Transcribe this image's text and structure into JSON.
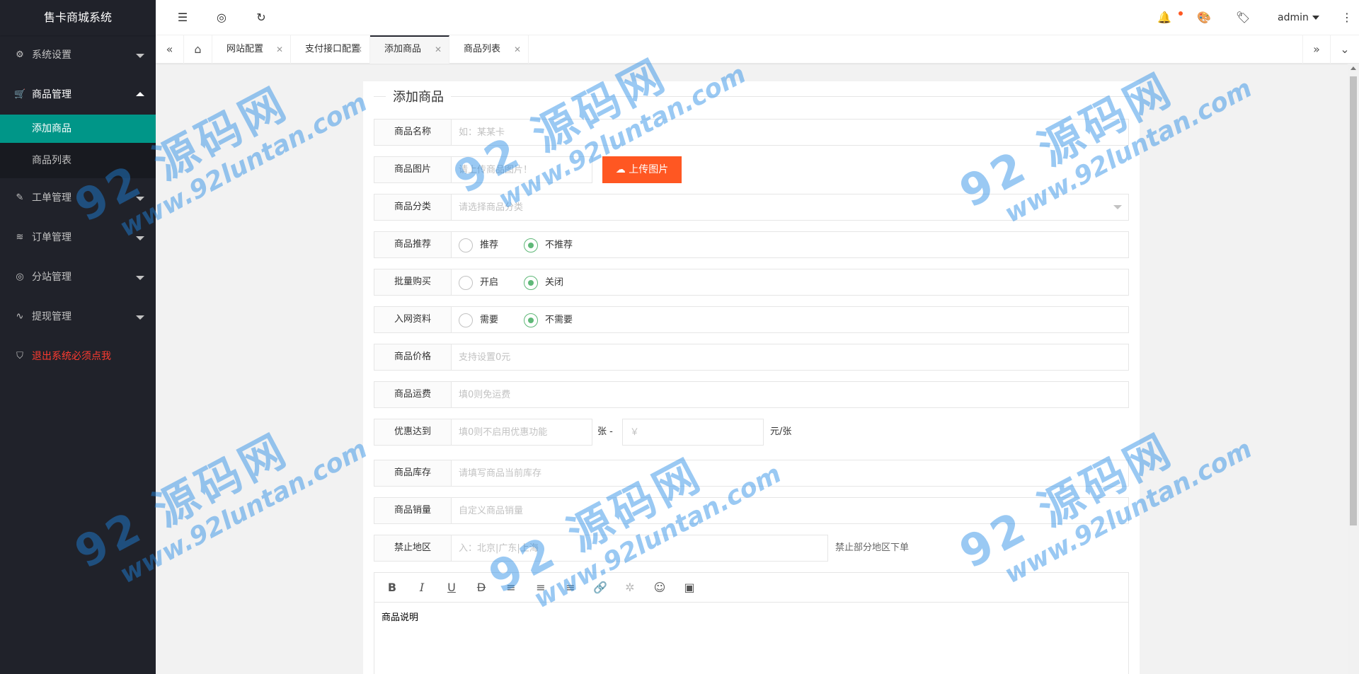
{
  "app": {
    "title": "售卡商城系统"
  },
  "sidebar": {
    "items": [
      {
        "label": "系统设置",
        "icon": "gear-icon"
      },
      {
        "label": "商品管理",
        "icon": "cart-icon"
      },
      {
        "label": "工单管理",
        "icon": "ticket-icon"
      },
      {
        "label": "订单管理",
        "icon": "layers-icon"
      },
      {
        "label": "分站管理",
        "icon": "globe-icon"
      },
      {
        "label": "提现管理",
        "icon": "pulse-icon"
      },
      {
        "label": "退出系统必须点我",
        "icon": "shield-icon"
      }
    ],
    "subitems": [
      {
        "label": "添加商品"
      },
      {
        "label": "商品列表"
      }
    ]
  },
  "header": {
    "user": "admin"
  },
  "tabs": [
    {
      "label": "网站配置"
    },
    {
      "label": "支付接口配置"
    },
    {
      "label": "添加商品"
    },
    {
      "label": "商品列表"
    }
  ],
  "form": {
    "legend": "添加商品",
    "name": {
      "label": "商品名称",
      "placeholder": "如：某某卡"
    },
    "image": {
      "label": "商品图片",
      "placeholder": "请上传商品图片！",
      "button": "上传图片"
    },
    "category": {
      "label": "商品分类",
      "placeholder": "请选择商品分类"
    },
    "recommend": {
      "label": "商品推荐",
      "options": [
        "推荐",
        "不推荐"
      ],
      "selected": "不推荐"
    },
    "batch": {
      "label": "批量购买",
      "options": [
        "开启",
        "关闭"
      ],
      "selected": "关闭"
    },
    "netinfo": {
      "label": "入网资料",
      "options": [
        "需要",
        "不需要"
      ],
      "selected": "不需要"
    },
    "price": {
      "label": "商品价格",
      "placeholder": "支持设置0元"
    },
    "shipping": {
      "label": "商品运费",
      "placeholder": "填0则免运费"
    },
    "discount": {
      "label": "优惠达到",
      "placeholder1": "填0则不启用优惠功能",
      "sep": "张 -",
      "placeholder2": "￥",
      "unit": "元/张"
    },
    "stock": {
      "label": "商品库存",
      "placeholder": "请填写商品当前库存"
    },
    "sales": {
      "label": "商品销量",
      "placeholder": "自定义商品销量"
    },
    "region": {
      "label": "禁止地区",
      "placeholder": "入：北京|广东|上海",
      "hint": "禁止部分地区下单"
    },
    "editor": {
      "content": "商品说明"
    }
  },
  "watermark": {
    "brand": "92 源码网",
    "url": "www.92luntan.com"
  },
  "colors": {
    "sidebar": "#20222a",
    "accent": "#009688",
    "upload": "#ff5722",
    "radio": "#5fb878",
    "danger": "#ff3b30"
  }
}
